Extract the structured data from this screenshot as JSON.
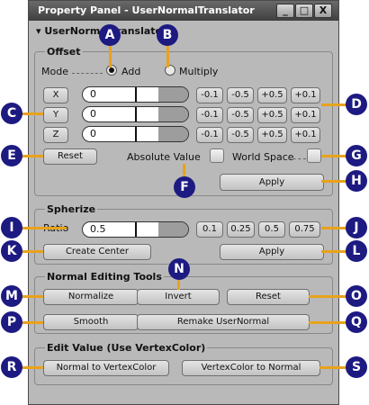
{
  "window": {
    "title": "Property Panel - UserNormalTranslator",
    "buttons": [
      "_",
      "□",
      "X"
    ]
  },
  "section_header": "UserNormalTranslator",
  "offset": {
    "title": "Offset",
    "mode_label": "Mode",
    "mode_options": [
      "Add",
      "Multiply"
    ],
    "mode_selected": "Add",
    "axes": [
      {
        "label": "X",
        "value": "0"
      },
      {
        "label": "Y",
        "value": "0"
      },
      {
        "label": "Z",
        "value": "0"
      }
    ],
    "step_buttons": [
      "-0.1",
      "-0.5",
      "+0.5",
      "+0.1"
    ],
    "reset_label": "Reset",
    "absolute_value_label": "Absolute Value",
    "world_space_label": "World Space",
    "apply_label": "Apply"
  },
  "spherize": {
    "title": "Spherize",
    "ratio_label": "Ratio",
    "ratio_value": "0.5",
    "presets": [
      "0.1",
      "0.25",
      "0.5",
      "0.75"
    ],
    "create_center_label": "Create Center",
    "apply_label": "Apply"
  },
  "normal_tools": {
    "title": "Normal Editing Tools",
    "buttons": [
      "Normalize",
      "Invert",
      "Reset",
      "Smooth",
      "Remake UserNormal"
    ]
  },
  "edit_value": {
    "title": "Edit Value (Use VertexColor)",
    "buttons": [
      "Normal to VertexColor",
      "VertexColor to Normal"
    ]
  },
  "markers": [
    "A",
    "B",
    "C",
    "D",
    "E",
    "F",
    "G",
    "H",
    "I",
    "J",
    "K",
    "L",
    "M",
    "N",
    "O",
    "P",
    "Q",
    "R",
    "S"
  ],
  "colors": {
    "marker": "#1d1a82",
    "leader": "#e8a21c",
    "panel": "#b9b9b9"
  }
}
